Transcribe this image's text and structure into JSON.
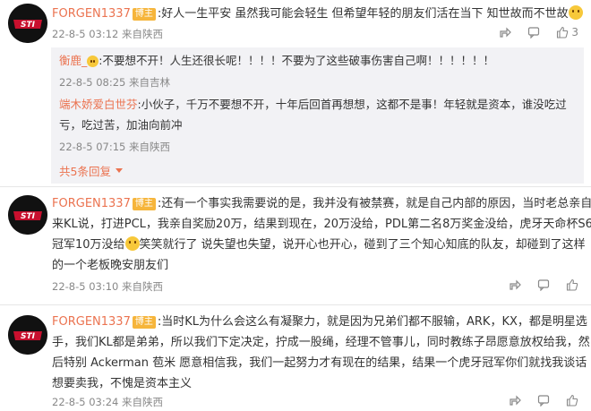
{
  "comments": [
    {
      "author": "FORGEN1337",
      "badge": "博主",
      "line1_a": ":好人一生平安 虽然我可能会轻生 但希望年轻的朋友们活在当下 知世故而不世故",
      "meta": "22-8-5 03:12 来自陕西",
      "replies": [
        {
          "author": "衡鹿_",
          "line1": ":不要想不开！人生还很长呢！！！！不要为了这些破事伤害自己啊！！！！！！",
          "meta": "22-8-5 08:25 来自吉林"
        },
        {
          "author": "端木娇爱白世芬",
          "line1": ":小伙子，千万不要想不开，十年后回首再想想，这都不是事！年轻就是资本，谁没吃过",
          "line2": "亏，吃过苦，加油向前冲",
          "meta": "22-8-5 07:15 来自陕西"
        }
      ],
      "more": "共5条回复"
    },
    {
      "author": "FORGEN1337",
      "badge": "博主",
      "line1": ":还有一个事实我需要说的是，我并没有被禁赛，就是自己内部的原因，当时老总亲自",
      "line2": "来KL说，打进PCL，我亲自奖励20万，结果到现在，20万没给，PDL第二名8万奖金没给，虎牙天命杯S6",
      "line3_a": "冠军10万没给",
      "line3_b": "笑笑就行了 说失望也失望，说开心也开心，碰到了三个知心知底的队友，却碰到了这样",
      "line4": "的一个老板晚安朋友们",
      "meta": "22-8-5 03:10 来自陕西"
    },
    {
      "author": "FORGEN1337",
      "badge": "博主",
      "line1": ":当时KL为什么会这么有凝聚力，就是因为兄弟们都不服输，ARK，KX，都是明星选",
      "line2": "手，我们KL都是弟弟，所以我们下定决定，拧成一股绳，经理不管事儿，同时教练子昂愿意放权给我，然",
      "line3": "后特别 Ackerman 苞米 愿意相信我，我们一起努力才有现在的结果，结果一个虎牙冠军你们就找我谈话",
      "line4": "想要卖我，不愧是资本主义",
      "meta": "22-8-5 03:24 来自陕西"
    }
  ],
  "actions": {
    "like_count": "3"
  },
  "icons": {
    "avatar": "sti-logo-icon",
    "share": "share-icon",
    "comment": "comment-icon",
    "like": "thumbs-up-icon",
    "emoji": "emoji-icon",
    "chevron": "chevron-down-icon"
  },
  "colors": {
    "author": "#eb7350",
    "badge": "#f6b53b",
    "meta": "#888888",
    "reply_bg": "#f2f2f5"
  }
}
